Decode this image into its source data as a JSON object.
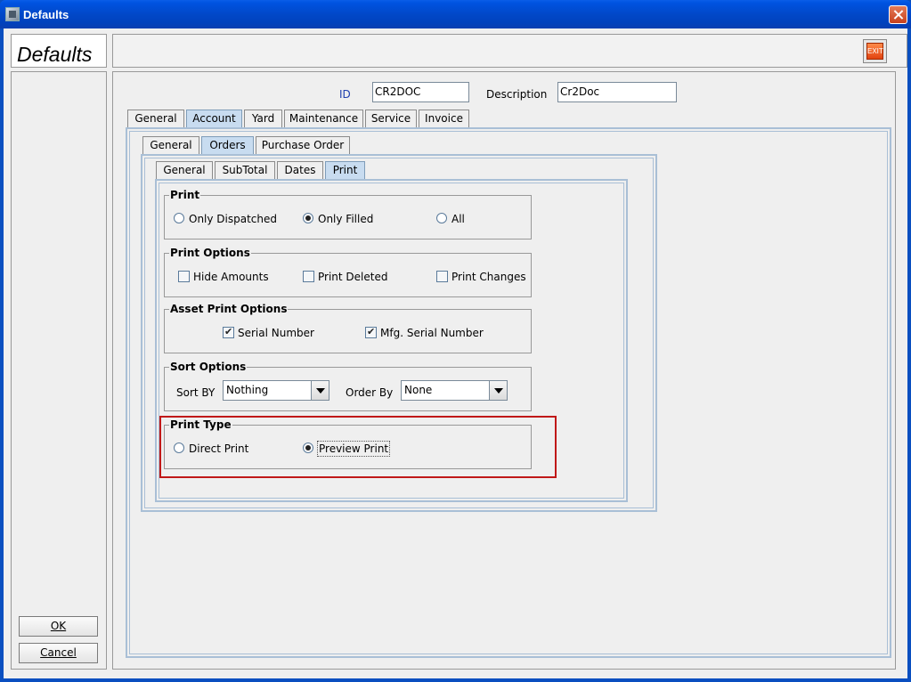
{
  "window": {
    "title": "Defaults"
  },
  "heading": "Defaults",
  "toolbar": {
    "exit_label": "EXIT"
  },
  "sidebar": {
    "ok_label": "OK",
    "cancel_label": "Cancel"
  },
  "form": {
    "id_label": "ID",
    "id_value": "CR2DOC",
    "description_label": "Description",
    "description_value": "Cr2Doc"
  },
  "tabs_top": [
    "General",
    "Account",
    "Yard",
    "Maintenance",
    "Service",
    "Invoice"
  ],
  "tabs_top_active": "Account",
  "tabs_account": [
    "General",
    "Orders",
    "Purchase Order"
  ],
  "tabs_account_active": "Orders",
  "tabs_orders": [
    "General",
    "SubTotal",
    "Dates",
    "Print"
  ],
  "tabs_orders_active": "Print",
  "print_group": {
    "title": "Print",
    "options": [
      "Only Dispatched",
      "Only Filled",
      "All"
    ],
    "selected": "Only Filled"
  },
  "print_options_group": {
    "title": "Print Options",
    "options": [
      {
        "label": "Hide Amounts",
        "checked": false
      },
      {
        "label": "Print Deleted",
        "checked": false
      },
      {
        "label": "Print Changes",
        "checked": false
      }
    ]
  },
  "asset_print_group": {
    "title": "Asset Print Options",
    "options": [
      {
        "label": "Serial Number",
        "checked": true
      },
      {
        "label": "Mfg. Serial Number",
        "checked": true
      }
    ]
  },
  "sort_group": {
    "title": "Sort Options",
    "sort_by_label": "Sort BY",
    "sort_by_value": "Nothing",
    "order_by_label": "Order By",
    "order_by_value": "None"
  },
  "print_type_group": {
    "title": "Print Type",
    "options": [
      "Direct Print",
      "Preview Print"
    ],
    "selected": "Preview Print"
  },
  "colors": {
    "highlight": "#c01818",
    "active_tab": "#c8dcf0",
    "titlebar": "#0148c8"
  }
}
